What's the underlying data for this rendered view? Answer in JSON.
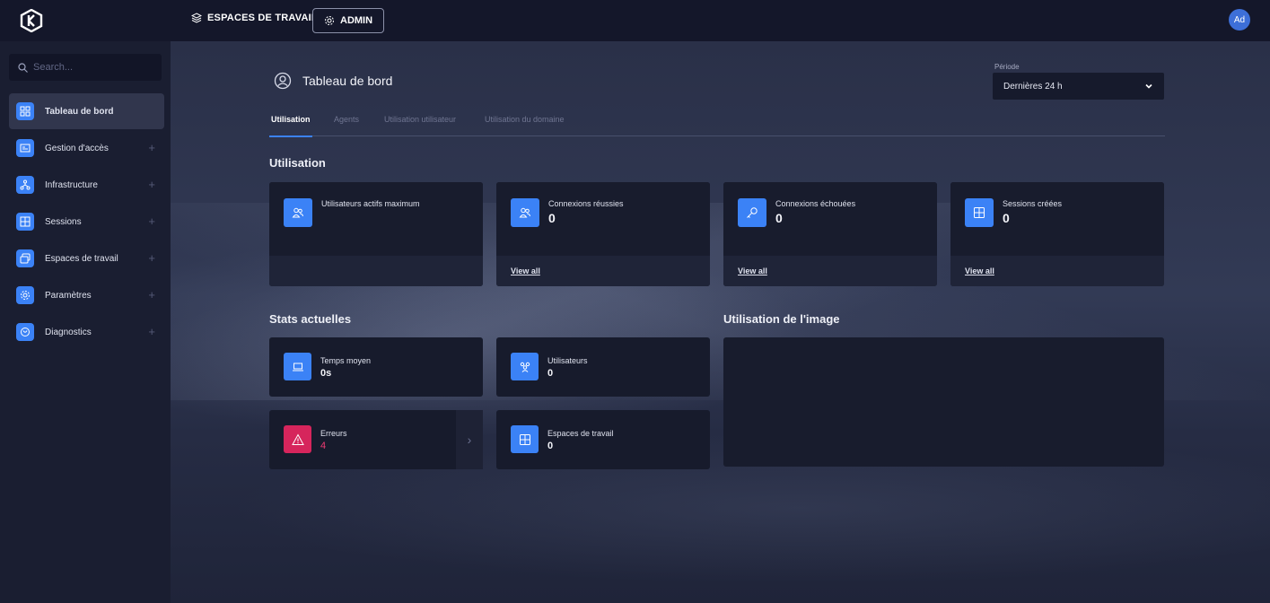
{
  "topbar": {
    "workspaces_label": "ESPACES DE TRAVAIL",
    "admin_label": "ADMIN",
    "avatar_initials": "Ad"
  },
  "sidebar": {
    "search_placeholder": "Search...",
    "items": [
      {
        "label": "Tableau de bord",
        "icon": "dashboard-icon",
        "active": true
      },
      {
        "label": "Gestion d'accès",
        "icon": "id-card-icon"
      },
      {
        "label": "Infrastructure",
        "icon": "network-icon"
      },
      {
        "label": "Sessions",
        "icon": "table-icon"
      },
      {
        "label": "Espaces de travail",
        "icon": "layers-icon"
      },
      {
        "label": "Paramètres",
        "icon": "gear-icon"
      },
      {
        "label": "Diagnostics",
        "icon": "stethoscope-icon"
      }
    ]
  },
  "main": {
    "title": "Tableau de bord",
    "period": {
      "label": "Période",
      "value": "Dernières 24 h"
    },
    "tabs": [
      "Utilisation",
      "Agents",
      "Utilisation utilisateur",
      "Utilisation du domaine"
    ],
    "usage_title": "Utilisation",
    "usage_cards": [
      {
        "label": "Utilisateurs actifs maximum",
        "value": "",
        "view_all": ""
      },
      {
        "label": "Connexions réussies",
        "value": "0",
        "view_all": "View all"
      },
      {
        "label": "Connexions échouées",
        "value": "0",
        "view_all": "View all"
      },
      {
        "label": "Sessions créées",
        "value": "0",
        "view_all": "View all"
      }
    ],
    "stats_title": "Stats actuelles",
    "stats": [
      {
        "label": "Temps moyen",
        "value": "0s"
      },
      {
        "label": "Utilisateurs",
        "value": "0"
      },
      {
        "label": "Erreurs",
        "value": "4"
      },
      {
        "label": "Espaces de travail",
        "value": "0"
      }
    ],
    "image_title": "Utilisation de l'image"
  },
  "colors": {
    "accent": "#3b82f6",
    "error": "#d6255c",
    "topbar": "#14172a",
    "sidebar": "#1a1e31"
  }
}
